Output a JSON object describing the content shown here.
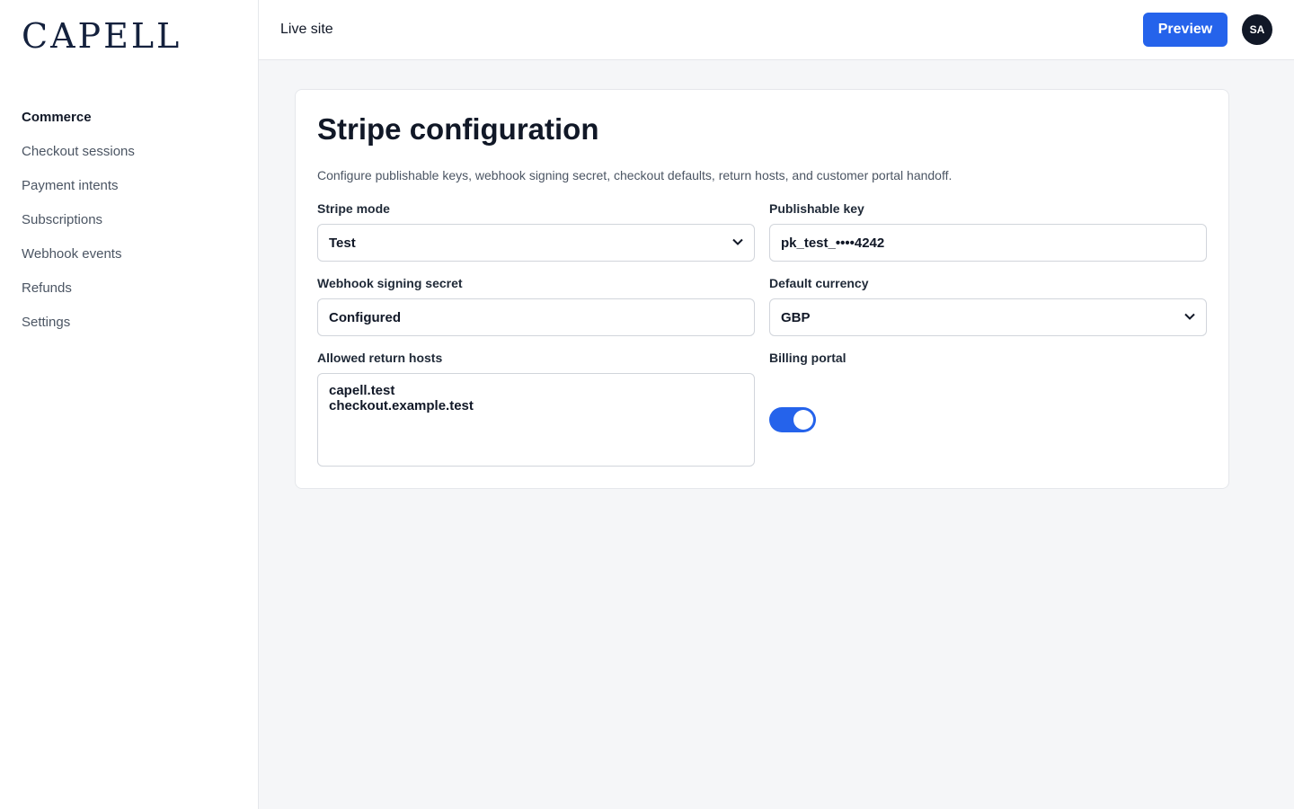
{
  "brand": {
    "logo": "CAPELL"
  },
  "sidebar": {
    "section": "Commerce",
    "items": [
      {
        "label": "Checkout sessions"
      },
      {
        "label": "Payment intents"
      },
      {
        "label": "Subscriptions"
      },
      {
        "label": "Webhook events"
      },
      {
        "label": "Refunds"
      },
      {
        "label": "Settings"
      }
    ]
  },
  "header": {
    "title": "Live site",
    "preview_label": "Preview",
    "avatar_initials": "SA"
  },
  "card": {
    "title": "Stripe configuration",
    "description": "Configure publishable keys, webhook signing secret, checkout defaults, return hosts, and customer portal handoff.",
    "fields": {
      "stripe_mode": {
        "label": "Stripe mode",
        "value": "Test"
      },
      "publishable_key": {
        "label": "Publishable key",
        "value": "pk_test_••••4242"
      },
      "webhook_secret": {
        "label": "Webhook signing secret",
        "value": "Configured"
      },
      "default_currency": {
        "label": "Default currency",
        "value": "GBP"
      },
      "return_hosts": {
        "label": "Allowed return hosts",
        "value": "capell.test\ncheckout.example.test"
      },
      "billing_portal": {
        "label": "Billing portal",
        "enabled": true
      }
    }
  },
  "colors": {
    "accent": "#2563eb",
    "brand": "#14213d"
  }
}
